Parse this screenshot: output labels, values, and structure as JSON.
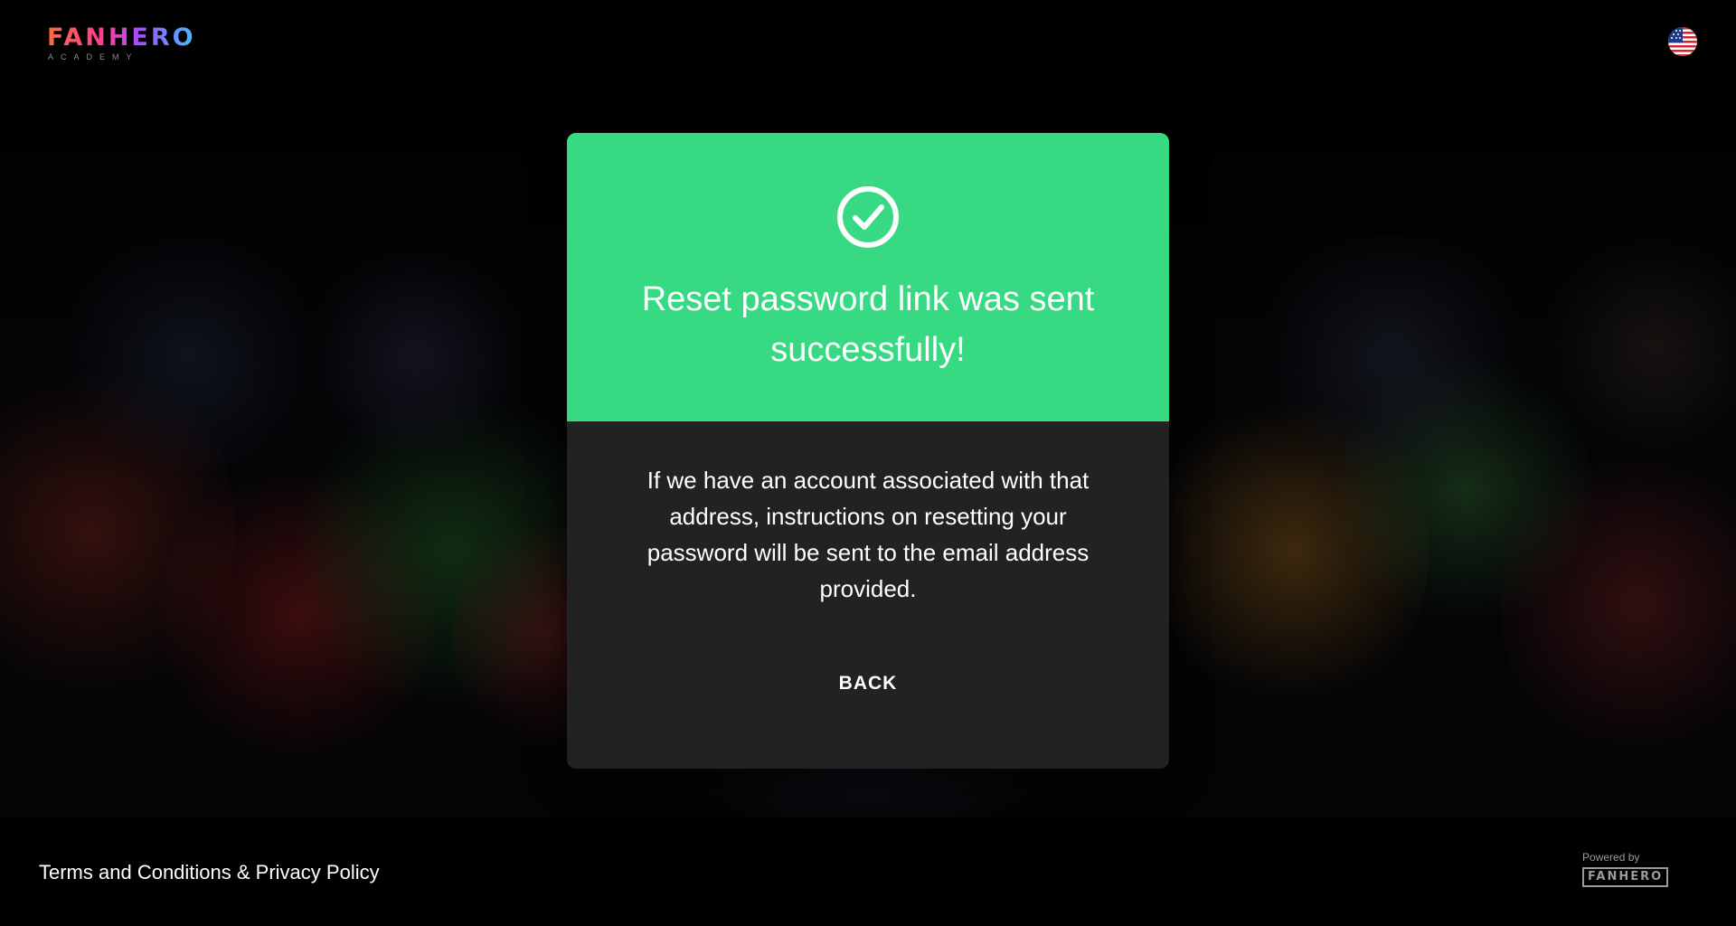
{
  "header": {
    "logo_text": "FANHERO",
    "logo_subtext": "ACADEMY",
    "language_icon": "us-flag-icon"
  },
  "modal": {
    "status_icon": "check-circle-icon",
    "title": "Reset password link was sent successfully!",
    "message": "If we have an account associated with that address, instructions on resetting your password will be sent to the email address provided.",
    "back_label": "BACK",
    "colors": {
      "header_bg": "#37da82",
      "body_bg": "#222222"
    }
  },
  "footer": {
    "terms_link": "Terms and Conditions & Privacy Policy",
    "powered_by_label": "Powered by",
    "powered_by_logo": "FANHERO"
  }
}
